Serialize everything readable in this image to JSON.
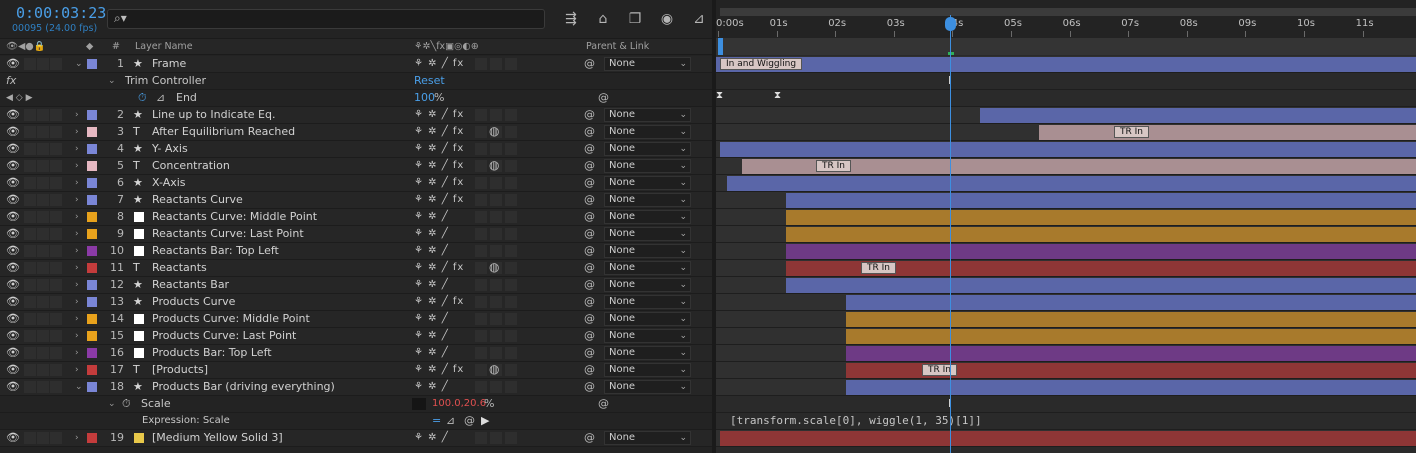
{
  "header": {
    "timecode": "0:00:03:23",
    "frames": "00095 (24.00 fps)",
    "search_placeholder": ""
  },
  "columns": {
    "hash": "#",
    "layer_name": "Layer Name",
    "parent_link": "Parent & Link"
  },
  "ruler": {
    "ticks": [
      "0:00s",
      "01s",
      "02s",
      "03s",
      "04s",
      "05s",
      "06s",
      "07s",
      "08s",
      "09s",
      "10s",
      "11s"
    ]
  },
  "layers": [
    {
      "num": "1",
      "type": "star",
      "name": "Frame",
      "label_color": "#7a86d6",
      "expanded": true,
      "parent": "None",
      "fx": true
    },
    {
      "num": "2",
      "type": "star",
      "name": "Line up to Indicate Eq.",
      "label_color": "#7a86d6",
      "parent": "None",
      "fx": true
    },
    {
      "num": "3",
      "type": "text",
      "name": "After Equilibrium Reached",
      "label_color": "#e6b8c2",
      "parent": "None",
      "fx": true
    },
    {
      "num": "4",
      "type": "star",
      "name": "Y- Axis",
      "label_color": "#7a86d6",
      "parent": "None",
      "fx": true
    },
    {
      "num": "5",
      "type": "text",
      "name": "Concentration",
      "label_color": "#e6b8c2",
      "parent": "None",
      "fx": true
    },
    {
      "num": "6",
      "type": "star",
      "name": "X-Axis",
      "label_color": "#7a86d6",
      "parent": "None",
      "fx": true
    },
    {
      "num": "7",
      "type": "star",
      "name": "Reactants Curve",
      "label_color": "#7a86d6",
      "parent": "None",
      "fx": true
    },
    {
      "num": "8",
      "type": "solid",
      "name": "Reactants Curve: Middle Point",
      "label_color": "#e8a21c",
      "parent": "None"
    },
    {
      "num": "9",
      "type": "solid",
      "name": "Reactants Curve: Last Point",
      "label_color": "#e8a21c",
      "parent": "None"
    },
    {
      "num": "10",
      "type": "solid",
      "name": "Reactants Bar: Top Left",
      "label_color": "#8b3aa6",
      "parent": "None"
    },
    {
      "num": "11",
      "type": "text",
      "name": "Reactants",
      "label_color": "#c43c3c",
      "parent": "None",
      "fx": true
    },
    {
      "num": "12",
      "type": "star",
      "name": "Reactants Bar",
      "label_color": "#7a86d6",
      "parent": "None"
    },
    {
      "num": "13",
      "type": "star",
      "name": "Products Curve",
      "label_color": "#7a86d6",
      "parent": "None",
      "fx": true
    },
    {
      "num": "14",
      "type": "solid",
      "name": "Products Curve: Middle Point",
      "label_color": "#e8a21c",
      "parent": "None"
    },
    {
      "num": "15",
      "type": "solid",
      "name": "Products Curve: Last Point",
      "label_color": "#e8a21c",
      "parent": "None"
    },
    {
      "num": "16",
      "type": "solid",
      "name": "Products Bar: Top Left",
      "label_color": "#8b3aa6",
      "parent": "None"
    },
    {
      "num": "17",
      "type": "text",
      "name": "[Products]",
      "label_color": "#c43c3c",
      "parent": "None",
      "fx": true
    },
    {
      "num": "18",
      "type": "star",
      "name": "Products Bar (driving everything)",
      "label_color": "#7a86d6",
      "expanded": true,
      "parent": "None"
    },
    {
      "num": "19",
      "type": "solid",
      "name": "[Medium Yellow Solid 3]",
      "label_color": "#c43c3c",
      "parent": "None",
      "swatch": "#e8c84a"
    }
  ],
  "properties": {
    "trim_controller": "Trim Controller",
    "reset": "Reset",
    "end": "End",
    "end_value": "100",
    "end_unit": "%",
    "scale": "Scale",
    "scale_value": "100.0,20.6",
    "scale_unit": "%",
    "expression_label": "Expression: Scale",
    "expression_text": "[transform.scale[0], wiggle(1, 35)[1]]"
  },
  "bars": {
    "frame_marker": "In and Wiggling",
    "tr_in": "TR In"
  },
  "colors": {
    "blue": "#5a66a8",
    "pink": "#a98f92",
    "orange": "#a87a2c",
    "purple": "#6e3a85",
    "red": "#8e3636",
    "accent": "#3d8fe0"
  }
}
